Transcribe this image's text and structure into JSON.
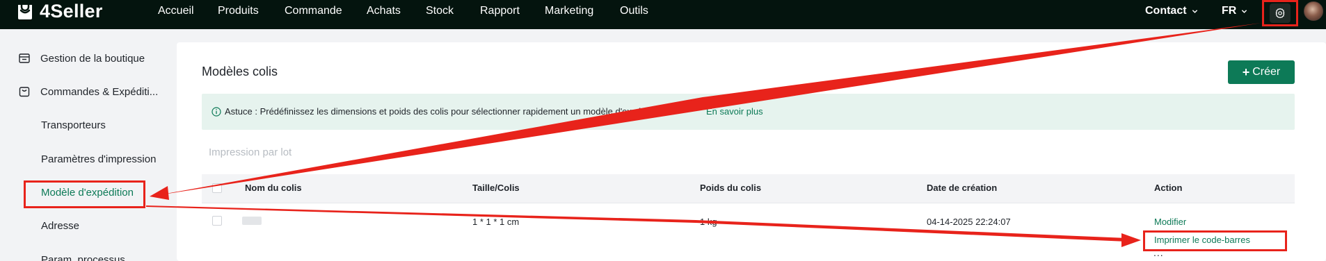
{
  "app": {
    "logo_text": "4Seller"
  },
  "nav": {
    "items": [
      "Accueil",
      "Produits",
      "Commande",
      "Achats",
      "Stock",
      "Rapport",
      "Marketing",
      "Outils"
    ],
    "contact_label": "Contact",
    "language_label": "FR"
  },
  "sidebar": {
    "groups": [
      {
        "label": "Gestion de la boutique",
        "icon": "store-icon"
      },
      {
        "label": "Commandes & Expéditi...",
        "icon": "orders-icon"
      }
    ],
    "sub_items": [
      "Transporteurs",
      "Paramètres d'impression",
      "Modèle d'expédition",
      "Adresse",
      "Param. processus"
    ],
    "active_item": "Modèle d'expédition"
  },
  "main": {
    "title": "Modèles colis",
    "create_label": "Créer",
    "tip_text": "Astuce : Prédéfinissez les dimensions et poids des colis pour sélectionner rapidement un modèle d'expédition",
    "tip_link": "En savoir plus",
    "batch_print_label": "Impression par lot"
  },
  "table": {
    "columns": [
      "Nom du colis",
      "Taille/Colis",
      "Poids du colis",
      "Date de création",
      "Action"
    ],
    "rows": [
      {
        "size": "1 * 1 * 1 cm",
        "weight": "1 kg",
        "created": "04-14-2025 22:24:07",
        "actions": {
          "edit": "Modifier",
          "print_barcode": "Imprimer le code-barres",
          "more": "..."
        }
      }
    ]
  },
  "colors": {
    "accent": "#0d7a57",
    "topbar": "#04140e",
    "annotation": "#e8231b",
    "tip_background": "#e6f3ee"
  }
}
